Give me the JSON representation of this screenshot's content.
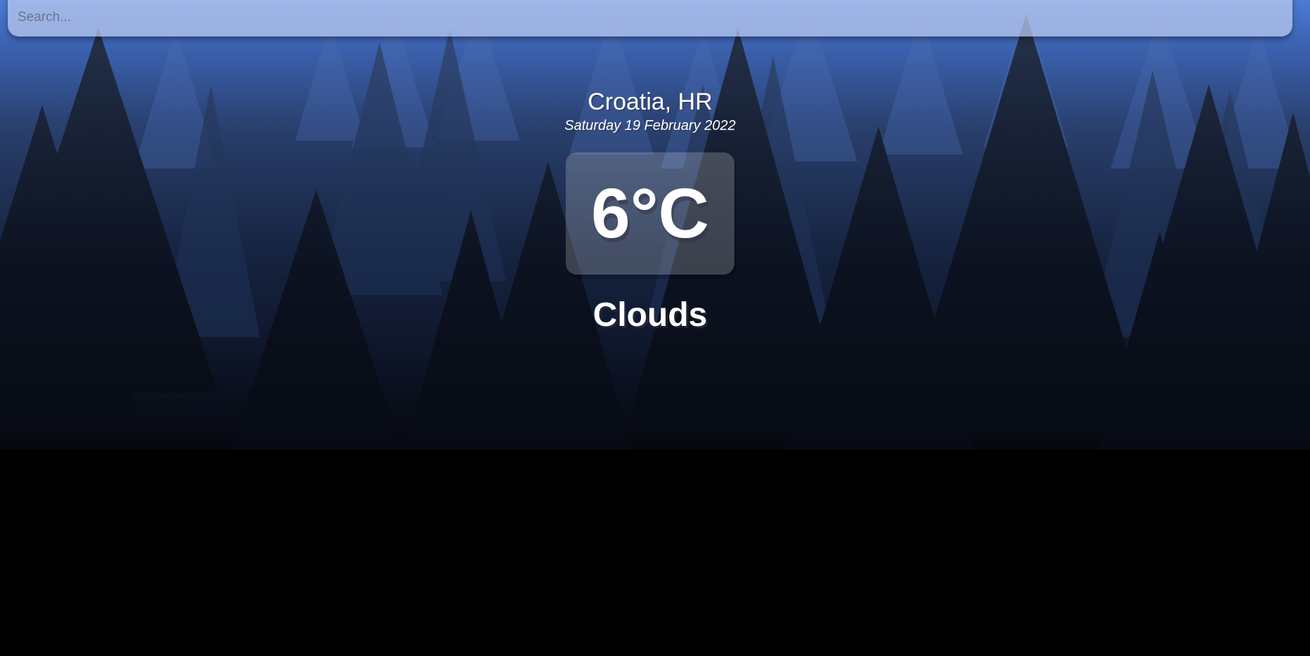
{
  "search": {
    "placeholder": "Search...",
    "value": ""
  },
  "location_box": {
    "location": "Croatia, HR",
    "date": "Saturday 19 February 2022"
  },
  "weather_box": {
    "temperature": "6°C",
    "condition": "Clouds"
  },
  "background": {
    "scene": "night-forest-background",
    "colors": {
      "sky_top": "#3b6fd6",
      "sky_mid": "#1b2f57",
      "ground": "#000000"
    }
  }
}
